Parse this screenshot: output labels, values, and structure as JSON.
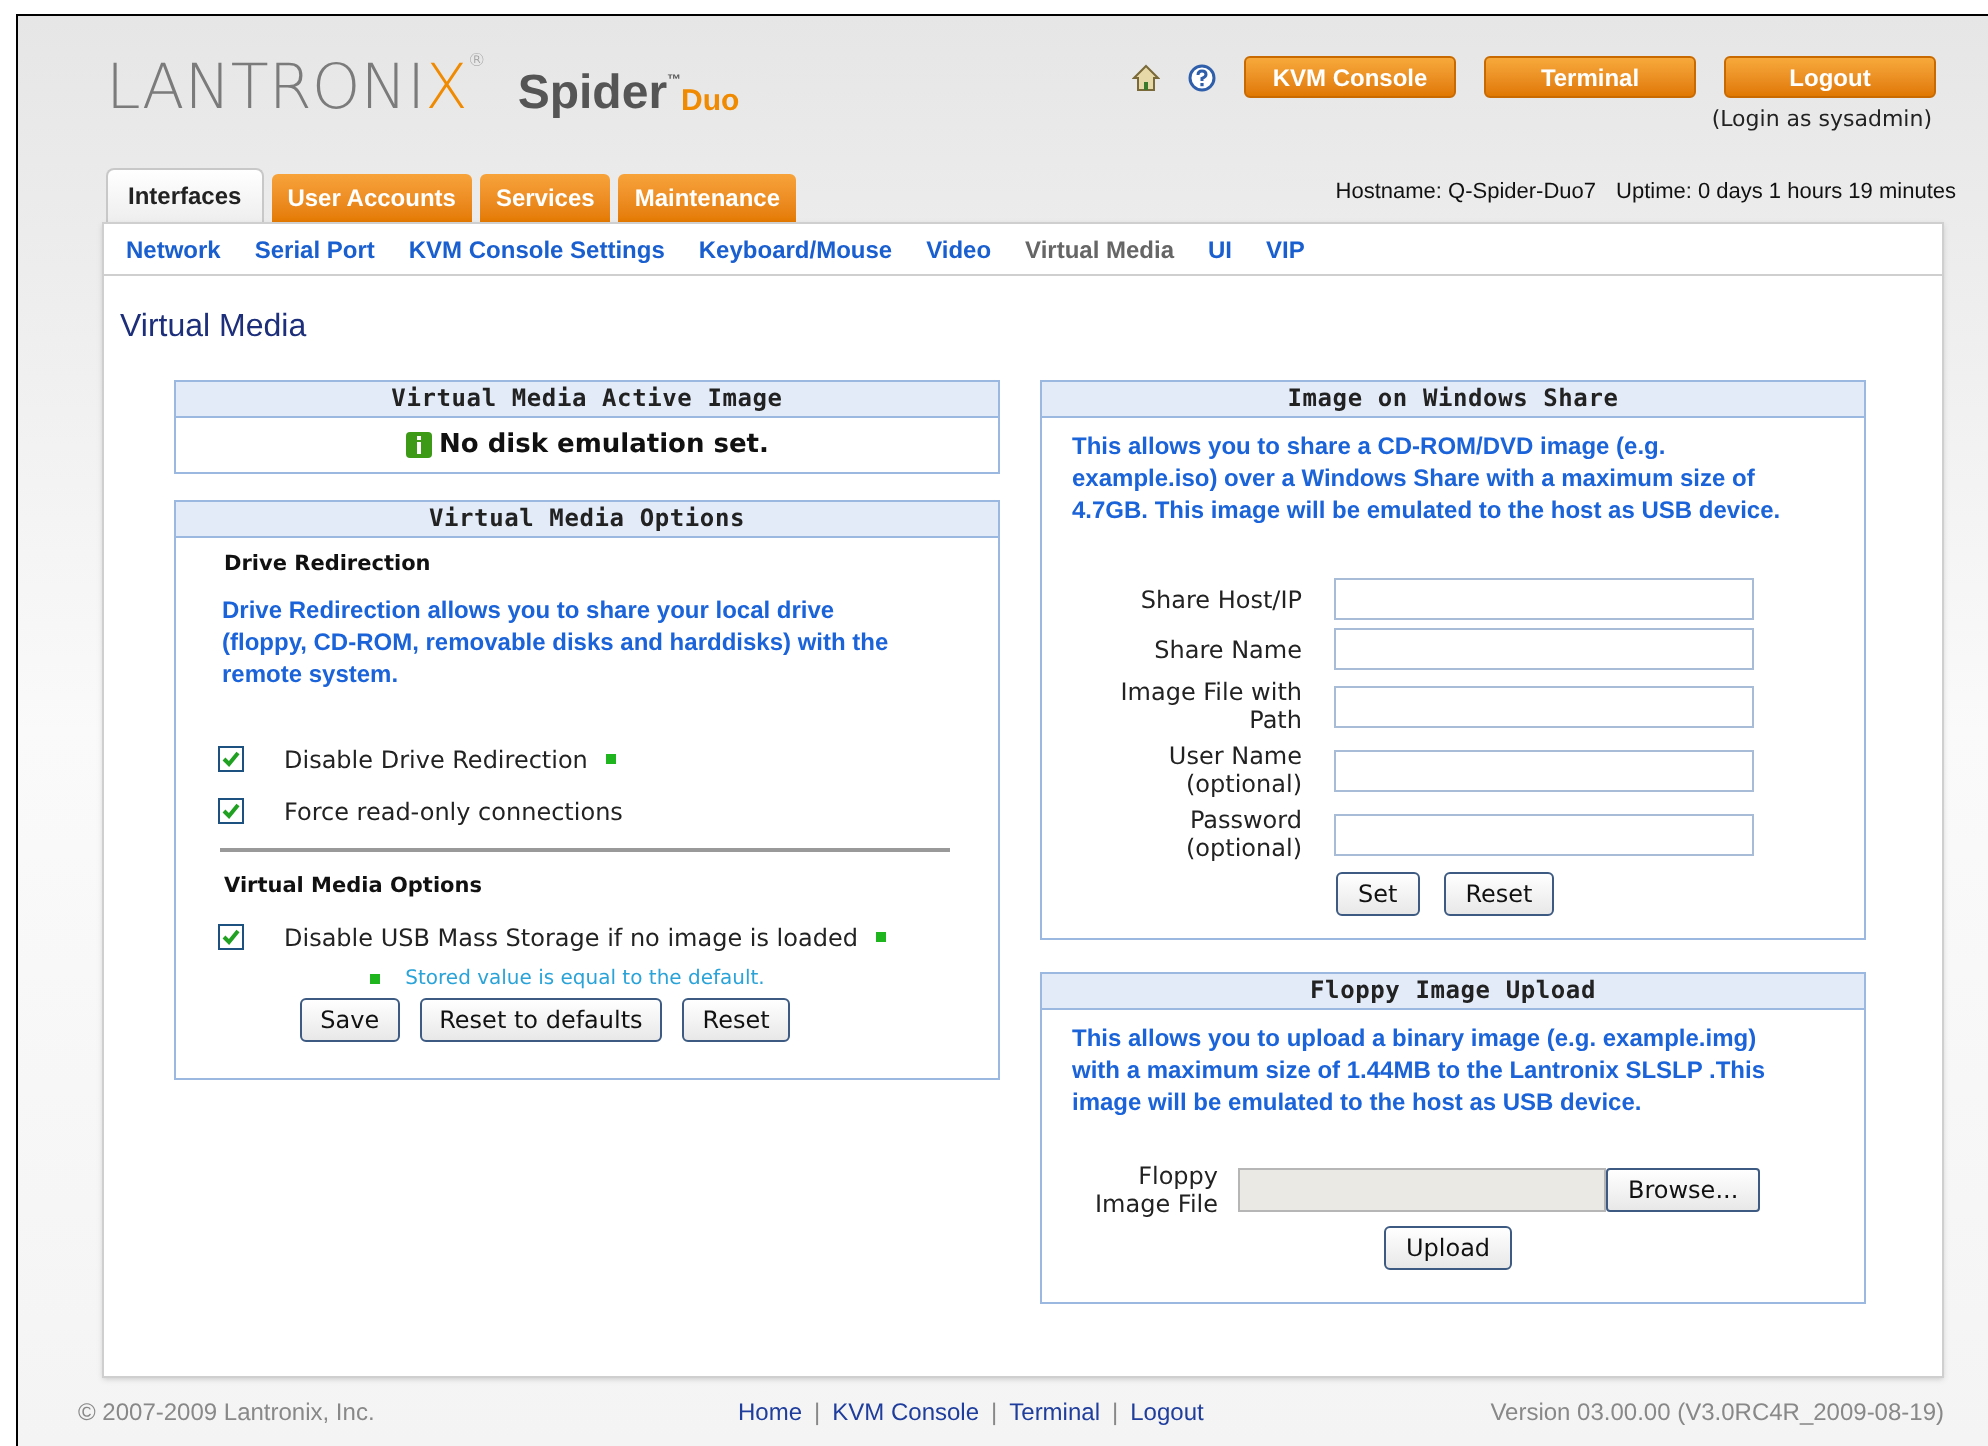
{
  "logo": {
    "brand": "LANTRONIX",
    "brand_mark": "®",
    "product": "Spider",
    "product_mark": "™",
    "product_suffix": "Duo"
  },
  "header_buttons": [
    "KVM Console",
    "Terminal",
    "Logout"
  ],
  "login_note": "(Login as sysadmin)",
  "main_tabs": [
    {
      "label": "Interfaces",
      "selected": true
    },
    {
      "label": "User Accounts",
      "selected": false
    },
    {
      "label": "Services",
      "selected": false
    },
    {
      "label": "Maintenance",
      "selected": false
    }
  ],
  "host_info": {
    "hostname": "Hostname: Q-Spider-Duo7",
    "uptime": "Uptime: 0 days 1 hours 19 minutes"
  },
  "sub_nav": [
    {
      "label": "Network",
      "selected": false
    },
    {
      "label": "Serial Port",
      "selected": false
    },
    {
      "label": "KVM Console Settings",
      "selected": false
    },
    {
      "label": "Keyboard/Mouse",
      "selected": false
    },
    {
      "label": "Video",
      "selected": false
    },
    {
      "label": "Virtual Media",
      "selected": true
    },
    {
      "label": "UI",
      "selected": false
    },
    {
      "label": "VIP",
      "selected": false
    }
  ],
  "page_title": "Virtual Media",
  "active_image": {
    "title": "Virtual Media Active Image",
    "message": "No disk emulation set."
  },
  "options": {
    "title": "Virtual Media Options",
    "sections": [
      {
        "heading": "Drive Redirection",
        "description": "Drive Redirection allows you to share your local drive (floppy, CD-ROM, removable disks and harddisks) with the remote system.",
        "options": [
          {
            "label": "Disable Drive Redirection",
            "checked": true,
            "at_default": true
          },
          {
            "label": "Force read-only connections",
            "checked": true,
            "at_default": false
          }
        ]
      },
      {
        "heading": "Virtual Media Options",
        "options": [
          {
            "label": "Disable USB Mass Storage if no image is loaded",
            "checked": true,
            "at_default": true
          }
        ]
      }
    ],
    "legend": "Stored value is equal to the default.",
    "buttons": [
      "Save",
      "Reset to defaults",
      "Reset"
    ]
  },
  "windows_share": {
    "title": "Image on Windows Share",
    "description": "This allows you to share a CD-ROM/DVD image (e.g. example.iso) over a Windows Share with a maximum size of 4.7GB. This image will be emulated to the host as USB device.",
    "fields": [
      {
        "label": "Share Host/IP"
      },
      {
        "label": "Share Name"
      },
      {
        "label": "Image File with Path"
      },
      {
        "label": "User Name (optional)"
      },
      {
        "label": "Password (optional)"
      }
    ],
    "buttons": [
      "Set",
      "Reset"
    ]
  },
  "floppy": {
    "title": "Floppy Image Upload",
    "description": "This allows you to upload a binary image (e.g. example.img) with a maximum size of 1.44MB to the Lantronix SLSLP .This image will be emulated to the host as USB device.",
    "file_label": "Floppy Image File",
    "browse": "Browse...",
    "button": "Upload"
  },
  "footer": {
    "copyright": "© 2007-2009 Lantronix, Inc.",
    "links": [
      "Home",
      "KVM Console",
      "Terminal",
      "Logout"
    ],
    "separators": [
      "|",
      "|",
      "|"
    ],
    "version": "Version 03.00.00 (V3.0RC4R_2009-08-19)"
  }
}
